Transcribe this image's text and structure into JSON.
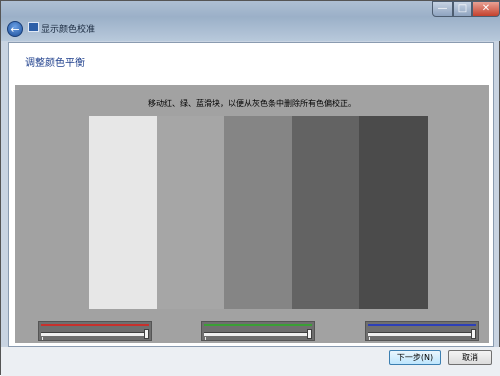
{
  "window": {
    "title": "显示颜色校准",
    "controls": {
      "minimize": "—",
      "maximize": "□",
      "close": "✕"
    }
  },
  "page": {
    "heading": "调整颜色平衡",
    "instruction": "移动红、绿、蓝滑块，以便从灰色条中删除所有色偏校正。"
  },
  "color_bars": [
    "#e7e7e7",
    "#a6a6a6",
    "#858585",
    "#636363",
    "#4b4b4b"
  ],
  "sliders": [
    {
      "name": "red",
      "color": "#c8302c",
      "value": 1.0
    },
    {
      "name": "green",
      "color": "#3aa035",
      "value": 1.0
    },
    {
      "name": "blue",
      "color": "#2c3fb8",
      "value": 1.0
    }
  ],
  "buttons": {
    "next": "下一步(N)",
    "cancel": "取消"
  },
  "icons": {
    "back": "back-arrow-icon",
    "app": "display-calibration-icon"
  }
}
